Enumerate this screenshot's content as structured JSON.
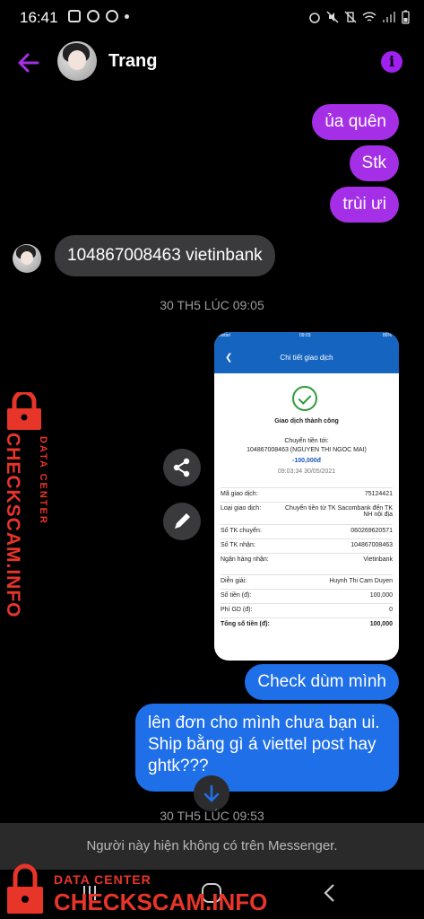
{
  "status_bar": {
    "time": "16:41"
  },
  "header": {
    "contact_name": "Trang"
  },
  "messages": {
    "m1": "ủa quên",
    "m2": "Stk",
    "m3": "trùi ưi",
    "m4": "104867008463 vietinbank",
    "ts1": "30 TH5 LÚC 09:05",
    "m5": "Check dùm mình",
    "m6_line1": "lên đơn cho mình chưa bạn ui.",
    "m6_line2": "Ship bằng gì á viettel post hay",
    "m6_line3": "ghtk???",
    "ts2": "30 TH5 LÚC 09:53"
  },
  "receipt": {
    "carrier": "Viettel",
    "clock": "09:03",
    "battery": "86%",
    "title": "Chi tiết giao dịch",
    "success": "Giao dịch thành công",
    "transfer_to_label": "Chuyển tiền tới:",
    "transfer_to": "104867008463 (NGUYEN THI NGOC MAI)",
    "amount": "-100,000đ",
    "datetime": "09:03:34 30/05/2021",
    "rows": [
      {
        "k": "Mã giao dịch:",
        "v": "75124421"
      },
      {
        "k": "Loại giao dịch:",
        "v": "Chuyển tiền từ TK Sacombank đến TK NH nội địa"
      },
      {
        "k": "Số TK chuyển:",
        "v": "060269620571"
      },
      {
        "k": "Số TK nhận:",
        "v": "104867008463"
      },
      {
        "k": "Ngân hàng nhận:",
        "v": "Vietinbank"
      },
      {
        "k": "Diễn giải:",
        "v": "Huynh Thi Cam Duyen"
      },
      {
        "k": "Số tiền (đ):",
        "v": "100,000"
      },
      {
        "k": "Phí GD (đ):",
        "v": "0"
      },
      {
        "k": "Tổng số tiền (đ):",
        "v": "100,000"
      }
    ]
  },
  "banner": "Người này hiện không có trên Messenger.",
  "watermark": {
    "vertical_small": "DATA CENTER",
    "vertical_big": "CHECKSCAM.INFO",
    "bottom_small": "DATA CENTER",
    "bottom_big": "CHECKSCAM.INFO"
  },
  "colors": {
    "accent": "#a52fe6",
    "blue": "#1e6fe8",
    "watermark": "#e8352a"
  }
}
